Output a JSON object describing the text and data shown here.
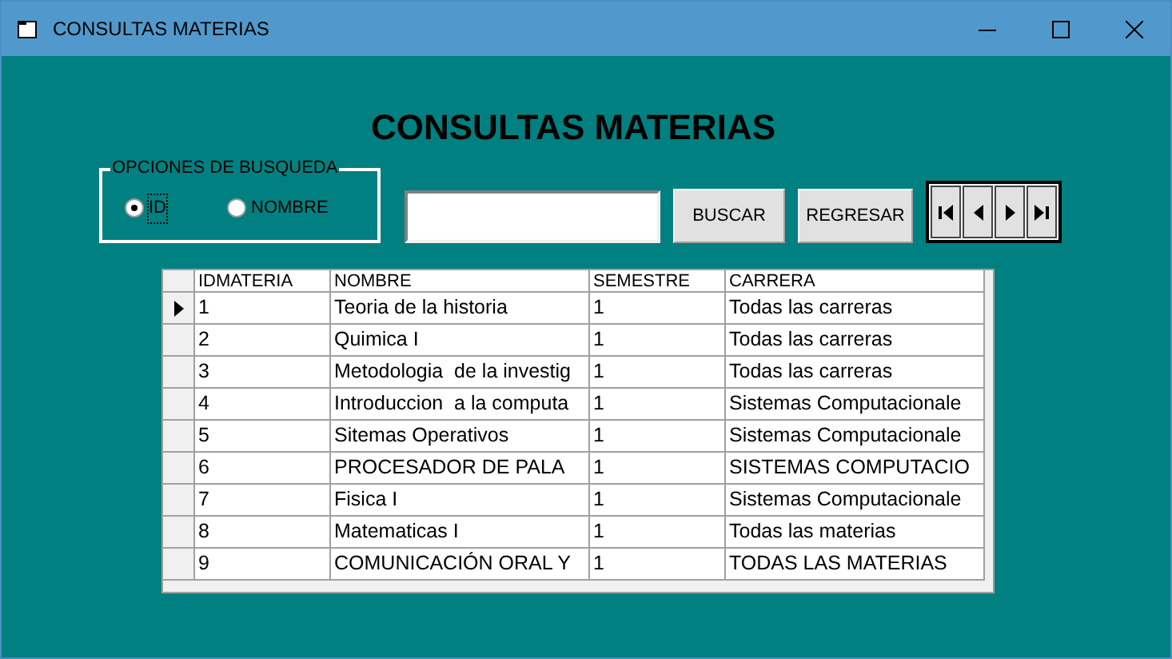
{
  "window": {
    "title": "CONSULTAS MATERIAS"
  },
  "heading": "CONSULTAS MATERIAS",
  "search_options": {
    "legend": "OPCIONES DE BUSQUEDA",
    "options": [
      {
        "label": "ID",
        "selected": true
      },
      {
        "label": "NOMBRE",
        "selected": false
      }
    ]
  },
  "buttons": [
    "BUSCAR",
    "REGRESAR"
  ],
  "table": {
    "columns": [
      "IDMATERIA",
      "NOMBRE",
      "SEMESTRE",
      "CARRERA"
    ],
    "rows": [
      {
        "selected": true,
        "cells": [
          "1",
          "Teoria de la historia",
          "1",
          "Todas las carreras"
        ]
      },
      {
        "selected": false,
        "cells": [
          "2",
          "Quimica I",
          "1",
          "Todas las carreras"
        ]
      },
      {
        "selected": false,
        "cells": [
          "3",
          "Metodologia  de la investig",
          "1",
          "Todas las carreras"
        ]
      },
      {
        "selected": false,
        "cells": [
          "4",
          "Introduccion  a la computa",
          "1",
          "Sistemas Computacionale"
        ]
      },
      {
        "selected": false,
        "cells": [
          "5",
          "Sitemas Operativos",
          "1",
          "Sistemas Computacionale"
        ]
      },
      {
        "selected": false,
        "cells": [
          "6",
          "PROCESADOR DE PALA",
          "1",
          "SISTEMAS COMPUTACIO"
        ]
      },
      {
        "selected": false,
        "cells": [
          "7",
          "Fisica I",
          "1",
          "Sistemas Computacionale"
        ]
      },
      {
        "selected": false,
        "cells": [
          "8",
          "Matematicas I",
          "1",
          "Todas las materias"
        ]
      },
      {
        "selected": false,
        "cells": [
          "9",
          "COMUNICACIÓN ORAL Y",
          "1",
          "TODAS LAS MATERIAS"
        ]
      }
    ]
  }
}
